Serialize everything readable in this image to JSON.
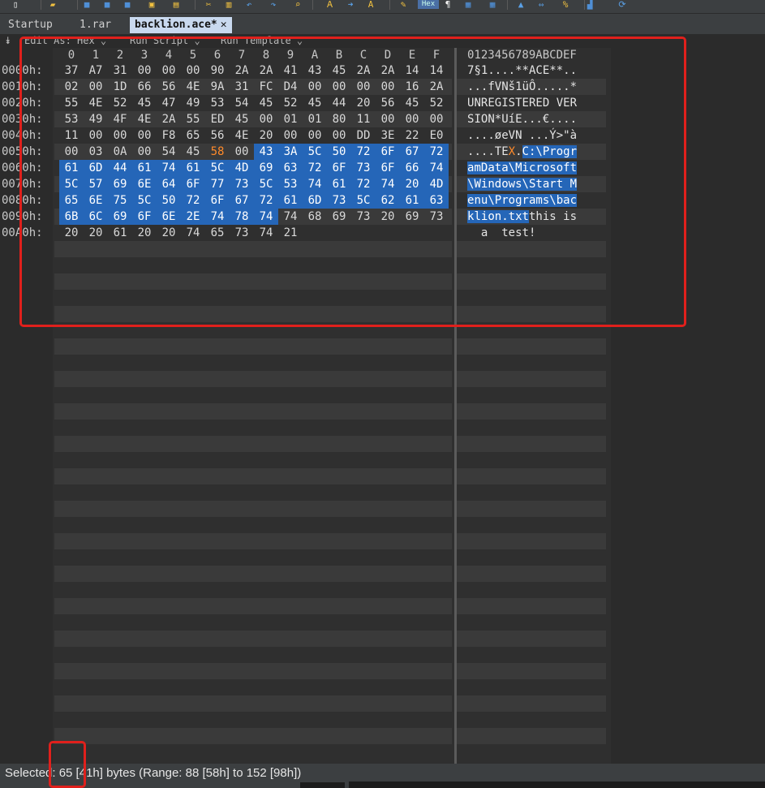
{
  "toolbar": {
    "icons": [
      "new-file-icon",
      "open-file-icon",
      "save-icon",
      "save-as-icon",
      "save-all-icon",
      "close-file-icon",
      "copy-icon",
      "cut-icon",
      "paste-icon",
      "undo-icon",
      "redo-icon",
      "find-icon",
      "replace-icon",
      "goto-icon",
      "text-icon",
      "highlight-icon",
      "hex-icon",
      "pilcrow-icon",
      "columns-icon",
      "calculator-icon",
      "export-icon",
      "compare-icon",
      "percent-icon",
      "histogram-icon",
      "sync-icon"
    ],
    "hex_label": "Hex"
  },
  "tabs": [
    {
      "label": "Startup",
      "active": false
    },
    {
      "label": "1.rar",
      "active": false
    },
    {
      "label": "backlion.ace*",
      "active": true
    }
  ],
  "subbar": {
    "edit_as": "Edit As: Hex ⌄",
    "run_script": "Run Script ⌄",
    "run_template": "Run Template ⌄"
  },
  "hex": {
    "column_headers": [
      "0",
      "1",
      "2",
      "3",
      "4",
      "5",
      "6",
      "7",
      "8",
      "9",
      "A",
      "B",
      "C",
      "D",
      "E",
      "F"
    ],
    "ascii_header": "0123456789ABCDEF",
    "rows": [
      {
        "addr": "0000h:",
        "bytes": [
          "37",
          "A7",
          "31",
          "00",
          "00",
          "00",
          "90",
          "2A",
          "2A",
          "41",
          "43",
          "45",
          "2A",
          "2A",
          "14",
          "14"
        ],
        "ascii": "7§1....**ACE**.."
      },
      {
        "addr": "0010h:",
        "bytes": [
          "02",
          "00",
          "1D",
          "66",
          "56",
          "4E",
          "9A",
          "31",
          "FC",
          "D4",
          "00",
          "00",
          "00",
          "00",
          "16",
          "2A"
        ],
        "ascii": "...fVNš1üÔ.....*"
      },
      {
        "addr": "0020h:",
        "bytes": [
          "55",
          "4E",
          "52",
          "45",
          "47",
          "49",
          "53",
          "54",
          "45",
          "52",
          "45",
          "44",
          "20",
          "56",
          "45",
          "52"
        ],
        "ascii": "UNREGISTERED VER"
      },
      {
        "addr": "0030h:",
        "bytes": [
          "53",
          "49",
          "4F",
          "4E",
          "2A",
          "55",
          "ED",
          "45",
          "00",
          "01",
          "01",
          "80",
          "11",
          "00",
          "00",
          "00"
        ],
        "ascii": "SION*UíE...€...."
      },
      {
        "addr": "0040h:",
        "bytes": [
          "11",
          "00",
          "00",
          "00",
          "F8",
          "65",
          "56",
          "4E",
          "20",
          "00",
          "00",
          "00",
          "DD",
          "3E",
          "22",
          "E0"
        ],
        "ascii": "....øeVN ...Ý>\"à"
      },
      {
        "addr": "0050h:",
        "bytes": [
          "00",
          "03",
          "0A",
          "00",
          "54",
          "45",
          "58",
          "00",
          "43",
          "3A",
          "5C",
          "50",
          "72",
          "6F",
          "67",
          "72"
        ],
        "ascii": "....TEX.C:\\Progr"
      },
      {
        "addr": "0060h:",
        "bytes": [
          "61",
          "6D",
          "44",
          "61",
          "74",
          "61",
          "5C",
          "4D",
          "69",
          "63",
          "72",
          "6F",
          "73",
          "6F",
          "66",
          "74"
        ],
        "ascii": "amData\\Microsoft"
      },
      {
        "addr": "0070h:",
        "bytes": [
          "5C",
          "57",
          "69",
          "6E",
          "64",
          "6F",
          "77",
          "73",
          "5C",
          "53",
          "74",
          "61",
          "72",
          "74",
          "20",
          "4D"
        ],
        "ascii": "\\Windows\\Start M"
      },
      {
        "addr": "0080h:",
        "bytes": [
          "65",
          "6E",
          "75",
          "5C",
          "50",
          "72",
          "6F",
          "67",
          "72",
          "61",
          "6D",
          "73",
          "5C",
          "62",
          "61",
          "63"
        ],
        "ascii": "enu\\Programs\\bac"
      },
      {
        "addr": "0090h:",
        "bytes": [
          "6B",
          "6C",
          "69",
          "6F",
          "6E",
          "2E",
          "74",
          "78",
          "74",
          "74",
          "68",
          "69",
          "73",
          "20",
          "69",
          "73"
        ],
        "ascii": "klion.txtthis is"
      },
      {
        "addr": "00A0h:",
        "bytes": [
          "20",
          "20",
          "61",
          "20",
          "20",
          "74",
          "65",
          "73",
          "74",
          "21"
        ],
        "ascii": "  a  test!"
      }
    ]
  },
  "status": {
    "text": "Selected: 65 [41h] bytes (Range: 88 [58h] to 152 [98h])"
  },
  "colors": {
    "selection": "#2566b8",
    "cursor_byte": "#ff8a2a",
    "annotation": "#e0201c"
  }
}
